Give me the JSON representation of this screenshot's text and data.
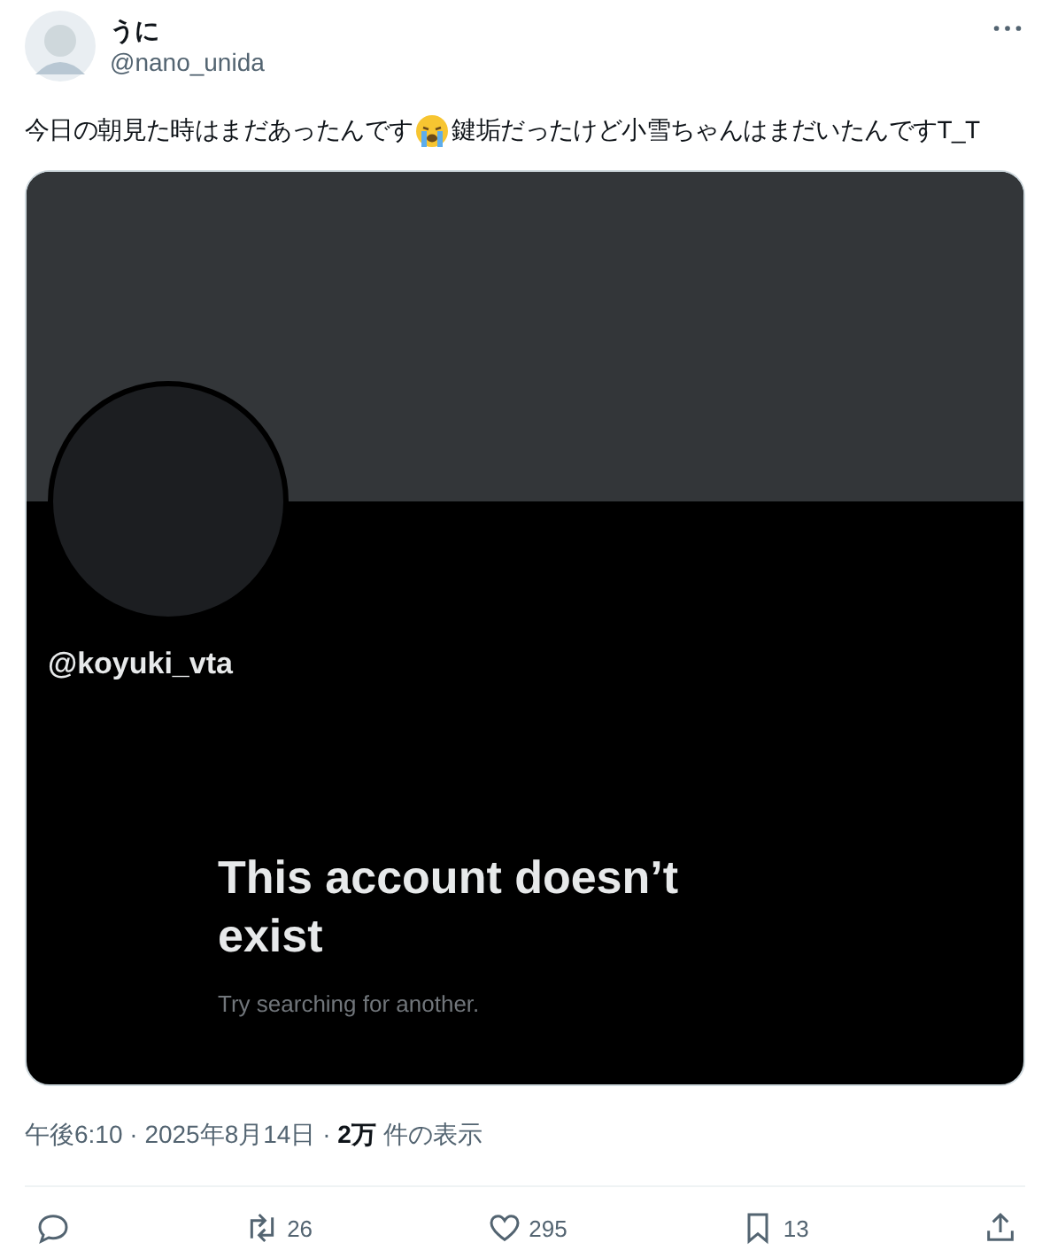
{
  "author": {
    "name": "うに",
    "handle": "@nano_unida"
  },
  "text": [
    "今日の朝見た時はまだあったんです",
    "鍵垢だったけど小雪ちゃんはまだいたんですT_T"
  ],
  "embedded_screenshot": {
    "handle": "@koyuki_vta",
    "title": "This account doesn’t exist",
    "subtitle": "Try searching for another."
  },
  "meta": "午後6:10 · 2025年8月14日 · **2万** 件の表示",
  "actions": [
    {
      "kind": "reply"
    },
    {
      "kind": "repost",
      "count": "26"
    },
    {
      "kind": "like",
      "count": "295"
    },
    {
      "kind": "bookmark",
      "count": "13"
    },
    {
      "kind": "share"
    }
  ]
}
